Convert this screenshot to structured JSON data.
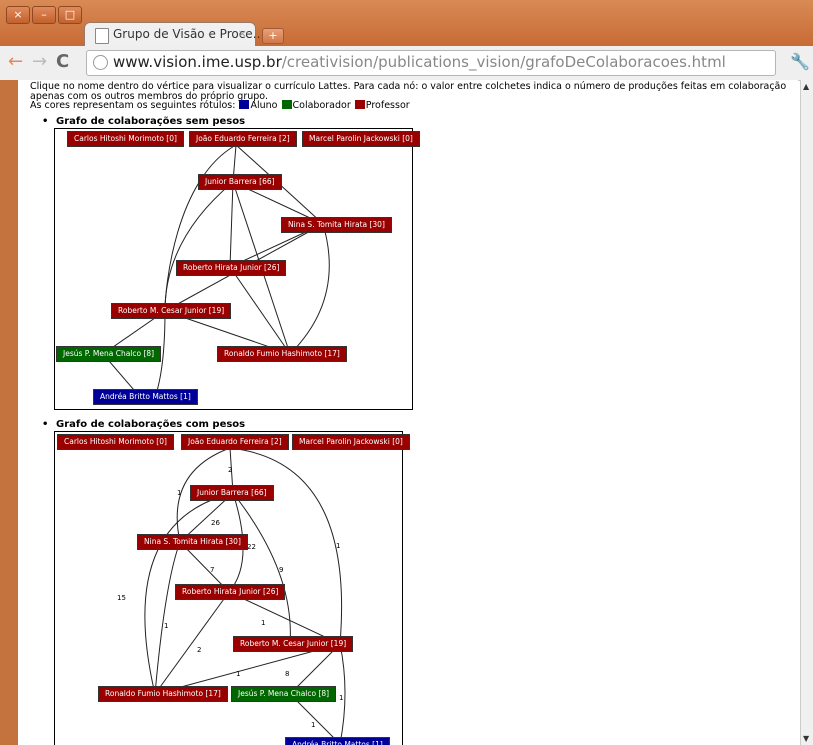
{
  "window": {
    "controls": [
      "×",
      "–",
      "□"
    ]
  },
  "tab": {
    "title": "Grupo de Visão e Proce…",
    "close": "×",
    "new_tab": "+"
  },
  "toolbar": {
    "back": "←",
    "forward": "→",
    "reload": "C",
    "url_host": "www.vision.ime.usp.br",
    "url_path": "/creativision/publications_vision/grafoDeColaboracoes.html",
    "wrench": "🔧"
  },
  "page": {
    "intro": "Clique no nome dentro do vértice para visualizar o currículo Lattes. Para cada nó: o valor entre colchetes indica o número de produções feitas em colaboração apenas com os outros membros do próprio grupo.",
    "legend_prefix": "As cores representam os seguintes rótulos:",
    "legend": [
      {
        "label": "Aluno",
        "color": "#000099"
      },
      {
        "label": "Colaborador",
        "color": "#006600"
      },
      {
        "label": "Professor",
        "color": "#990000"
      }
    ],
    "graph1_title": "Grafo de colaborações sem pesos",
    "graph2_title": "Grafo de colaborações com pesos"
  },
  "graph1": {
    "nodes": [
      {
        "label": "Carlos Hitoshi Morimoto [0]",
        "role": "prof"
      },
      {
        "label": "João Eduardo Ferreira [2]",
        "role": "prof"
      },
      {
        "label": "Marcel Parolin Jackowski [0]",
        "role": "prof"
      },
      {
        "label": "Junior Barrera [66]",
        "role": "prof"
      },
      {
        "label": "Nina S. Tomita Hirata [30]",
        "role": "prof"
      },
      {
        "label": "Roberto Hirata Junior [26]",
        "role": "prof"
      },
      {
        "label": "Roberto M. Cesar Junior [19]",
        "role": "prof"
      },
      {
        "label": "Jesús P. Mena Chalco [8]",
        "role": "colab"
      },
      {
        "label": "Ronaldo Fumio Hashimoto [17]",
        "role": "prof"
      },
      {
        "label": "Andréa Britto Mattos [1]",
        "role": "aluno"
      }
    ]
  },
  "graph2": {
    "nodes": [
      {
        "label": "Carlos Hitoshi Morimoto [0]",
        "role": "prof"
      },
      {
        "label": "João Eduardo Ferreira [2]",
        "role": "prof"
      },
      {
        "label": "Marcel Parolin Jackowski [0]",
        "role": "prof"
      },
      {
        "label": "Junior Barrera [66]",
        "role": "prof"
      },
      {
        "label": "Nina S. Tomita Hirata [30]",
        "role": "prof"
      },
      {
        "label": "Roberto Hirata Junior [26]",
        "role": "prof"
      },
      {
        "label": "Roberto M. Cesar Junior [19]",
        "role": "prof"
      },
      {
        "label": "Ronaldo Fumio Hashimoto [17]",
        "role": "prof"
      },
      {
        "label": "Jesús P. Mena Chalco [8]",
        "role": "colab"
      },
      {
        "label": "Andréa Britto Mattos [1]",
        "role": "aluno"
      }
    ],
    "edge_weights": [
      "2",
      "1",
      "26",
      "22",
      "9",
      "1",
      "7",
      "15",
      "1",
      "1",
      "2",
      "1",
      "8",
      "1",
      "1"
    ]
  }
}
